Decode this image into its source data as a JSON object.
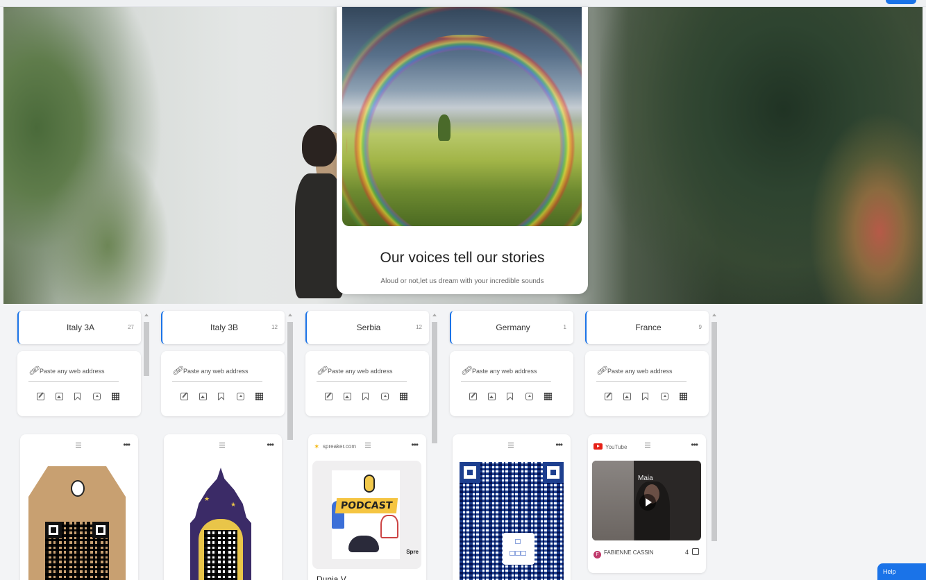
{
  "hero": {
    "title": "Our voices tell our stories",
    "subtitle": "Aloud or not,let us dream with your incredible sounds"
  },
  "composer": {
    "placeholder": "Paste any web address",
    "tools": [
      "edit-icon",
      "image-icon",
      "bookmark-icon",
      "upload-icon",
      "qr-code-icon"
    ]
  },
  "columns": [
    {
      "title": "Italy 3A",
      "count": "27"
    },
    {
      "title": "Italy 3B",
      "count": "12"
    },
    {
      "title": "Serbia",
      "count": "12"
    },
    {
      "title": "Germany",
      "count": "1"
    },
    {
      "title": "France",
      "count": "9"
    }
  ],
  "posts": {
    "serbia": {
      "source": "spreaker.com",
      "title": "Dunja V.",
      "art_label": "PODCAST",
      "art_brand": "Spre"
    },
    "france": {
      "source": "YouTube",
      "video_label": "Maia",
      "author": "FABIENNE CASSIN",
      "author_initial": "F",
      "likes": "4"
    }
  },
  "help": {
    "label": "Help"
  },
  "colors": {
    "accent": "#1a73e8",
    "card": "#ffffff",
    "background": "#f3f4f6"
  }
}
